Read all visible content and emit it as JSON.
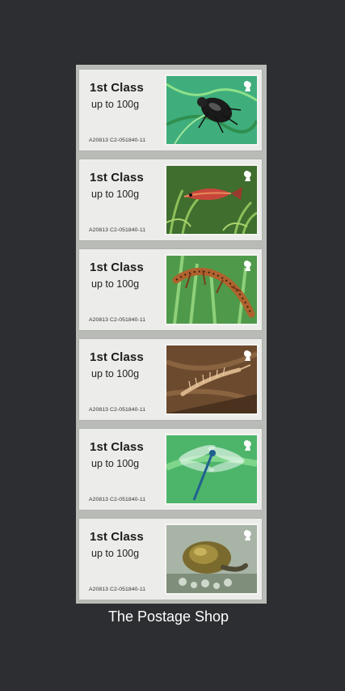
{
  "footer": "The Postage Shop",
  "labels": [
    {
      "class": "1st Class",
      "weight": "up to 100g",
      "code": "A20813 C2-051840-11",
      "species": "Lesser Silver Water Beetle"
    },
    {
      "class": "1st Class",
      "weight": "up to 100g",
      "code": "A20813 C2-051840-11",
      "species": "Three-spined Stickleback"
    },
    {
      "class": "1st Class",
      "weight": "up to 100g",
      "code": "A20813 C2-051840-11",
      "species": "Smooth Newt"
    },
    {
      "class": "1st Class",
      "weight": "up to 100g",
      "code": "A20813 C2-051840-11",
      "species": "Fairy Shrimp"
    },
    {
      "class": "1st Class",
      "weight": "up to 100g",
      "code": "A20813 C2-051840-11",
      "species": "Southern Damselfly"
    },
    {
      "class": "1st Class",
      "weight": "up to 100g",
      "code": "A20813 C2-051840-11",
      "species": "Great Pond Snail"
    }
  ]
}
